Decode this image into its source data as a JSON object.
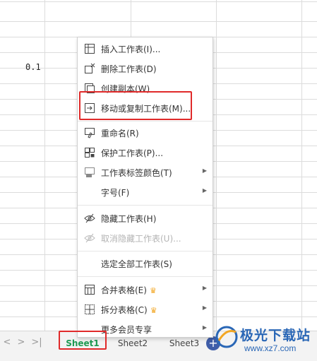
{
  "sheet": {
    "cell_value": "0.1",
    "tabs": [
      "Sheet1",
      "Sheet2",
      "Sheet3"
    ],
    "active_tab": "Sheet1",
    "nav_first": "|<",
    "nav_prev": "<",
    "nav_next": ">",
    "nav_last": ">|",
    "add_symbol": "+"
  },
  "context_menu": {
    "items": [
      {
        "label": "插入工作表(I)...",
        "icon": "insert-sheet-icon"
      },
      {
        "label": "删除工作表(D)",
        "icon": "delete-sheet-icon"
      },
      {
        "label": "创建副本(W)",
        "icon": "copy-sheet-icon"
      },
      {
        "label": "移动或复制工作表(M)...",
        "icon": "move-copy-sheet-icon"
      },
      {
        "label": "重命名(R)",
        "icon": "rename-icon"
      },
      {
        "label": "保护工作表(P)...",
        "icon": "protect-sheet-icon"
      },
      {
        "label": "工作表标签颜色(T)",
        "icon": "tab-color-icon"
      },
      {
        "label": "字号(F)",
        "icon": ""
      },
      {
        "label": "隐藏工作表(H)",
        "icon": "hide-eye-icon"
      },
      {
        "label": "取消隐藏工作表(U)...",
        "icon": "unhide-eye-icon"
      },
      {
        "label": "选定全部工作表(S)",
        "icon": ""
      },
      {
        "label": "合并表格(E)",
        "icon": "merge-table-icon"
      },
      {
        "label": "拆分表格(C)",
        "icon": "split-table-icon"
      },
      {
        "label": "更多会员专享",
        "icon": ""
      }
    ]
  },
  "watermark": {
    "brand": "极光下载站",
    "url": "www.xz7.com"
  },
  "colors": {
    "highlight": "#e02a2a",
    "active_tab": "#1e9a52",
    "crown": "#f2a623",
    "watermark": "#2a67b6"
  }
}
